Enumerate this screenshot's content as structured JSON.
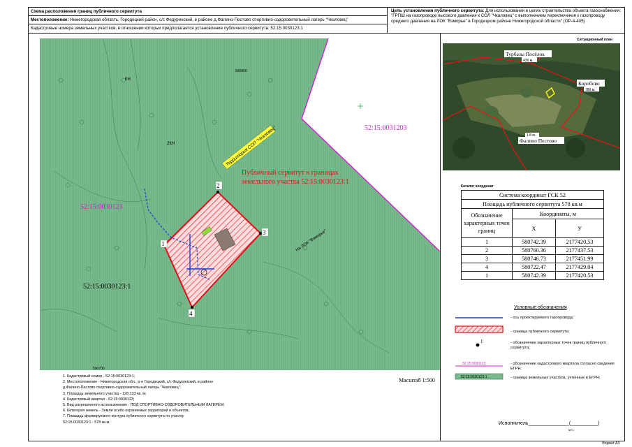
{
  "header": {
    "title": "Схема расположения границ публичного сервитута",
    "location_label": "Местоположение:",
    "location_value": "Нижегородская область, Городецкий район, с/с Федуринский, в районе д.Фалино-Пестово спортивно-оздоровительный лагерь \"Чкаловец\"",
    "cadastral_label": "Кадастровые номера земельных участков, в отношении которых предполагается установление публичного сервитута:",
    "cadastral_value": "52:15:0030123:1",
    "purpose_label": "Цель установления публичного сервитута:",
    "purpose_value": "Для использования в целях строительства объекта газоснабжения: \"ГРПШ на газопроводе высокого давления к СОЛ \"Чкаловец\" с выполнением переключения к газопроводу среднего давления на ЛОК \"Взморье\" в Городецком районе Нижегородской области\" (ОР-4-405)"
  },
  "map": {
    "parcel_left": "52:15:0030123",
    "parcel_bottom": "52:15:0030123:1",
    "parcel_right": "52:15:0031203",
    "servitude_label_line1": "Публичный сервитут в границах",
    "servitude_label_line2": "земельного участка 52:15:0030123:1",
    "yellow_label": "Территория СОЛ \"Чкаловец\"",
    "road_label": "На ЛОК \"Взморье\"",
    "kn_label": "КН",
    "kn2_label": "2КН",
    "point_labels": [
      "1",
      "2",
      "3",
      "4"
    ],
    "grid_labels": [
      "590800",
      "590700"
    ],
    "colors": {
      "green": "#77b98a",
      "servitude": "#e0101b",
      "gas": "#1d3bd6",
      "magenta": "#cf22d0"
    }
  },
  "situational": {
    "caption": "Ситуационный план",
    "turbaza": "Турбазы Посёлок",
    "turbaza_dist": "436 м.",
    "korobovo": "Коробово",
    "korobovo_dist": "789 м.",
    "falino": "Фалино Пестово",
    "falino_dist": "1.8 м."
  },
  "catalog": {
    "caption": "Каталог координат",
    "system": "Система координат ГСК 52",
    "area": "Площадь публичного сервитута 578 кв.м",
    "col_designation": "Обозначение характерных точек границ",
    "col_coords": "Координаты, м",
    "col_x": "Х",
    "col_y": "У",
    "rows": [
      {
        "n": "1",
        "x": "580742.39",
        "y": "2177420.53"
      },
      {
        "n": "2",
        "x": "580760.36",
        "y": "2177437.53"
      },
      {
        "n": "3",
        "x": "580746.73",
        "y": "2177451.99"
      },
      {
        "n": "4",
        "x": "580722.47",
        "y": "2177429.04"
      },
      {
        "n": "1",
        "x": "580742.39",
        "y": "2177420.53"
      }
    ]
  },
  "legend": {
    "title": "Условные обозначения",
    "items": [
      "- ось проектируемого газопровода;",
      "- граница публичного сервитута;",
      "- обозначение характерных точек границ публичного сервитута;",
      "- обозначение кадастрового квартала согласно сведения ЕГРН;",
      "- граница земельных участков, учтенные в ЕГРН;"
    ],
    "sample_quarter": "52:15:0030123",
    "sample_parcel": "52:15:0030123:1",
    "sample_point": "1"
  },
  "notes": [
    "1. Кадастровый номер - 52:15:0030123:1;",
    "2. Местоположение - Нижегородская обл., р-н Городецкий, с/с Федуринский, в районе",
    "д.Фалино-Пестово спортивно-оздоровительный лагерь \"Чкаловец\";",
    "3. Площадь земельного участка - 128 133 кв. м;",
    "4. Кадастровый квартал - 52:15:0030123;",
    "5. Вид разрешенного использования - ПОД СПОРТИВНО-ОЗДОРОВИТЕЛЬНЫМ ЛАГЕРЕМ;",
    "6. Категория земель - Земли особо охраняемых территорий и объектов;",
    "7. Площадь формируемого контура публичного сервитута по участку",
    "52:15:0030123:1 - 578 кв.м."
  ],
  "scale": "Масштаб 1:500",
  "executor_label": "Исполнитель",
  "executor_line": "_______________(__________)",
  "mp": "м.п.",
  "format": "Формат А3"
}
